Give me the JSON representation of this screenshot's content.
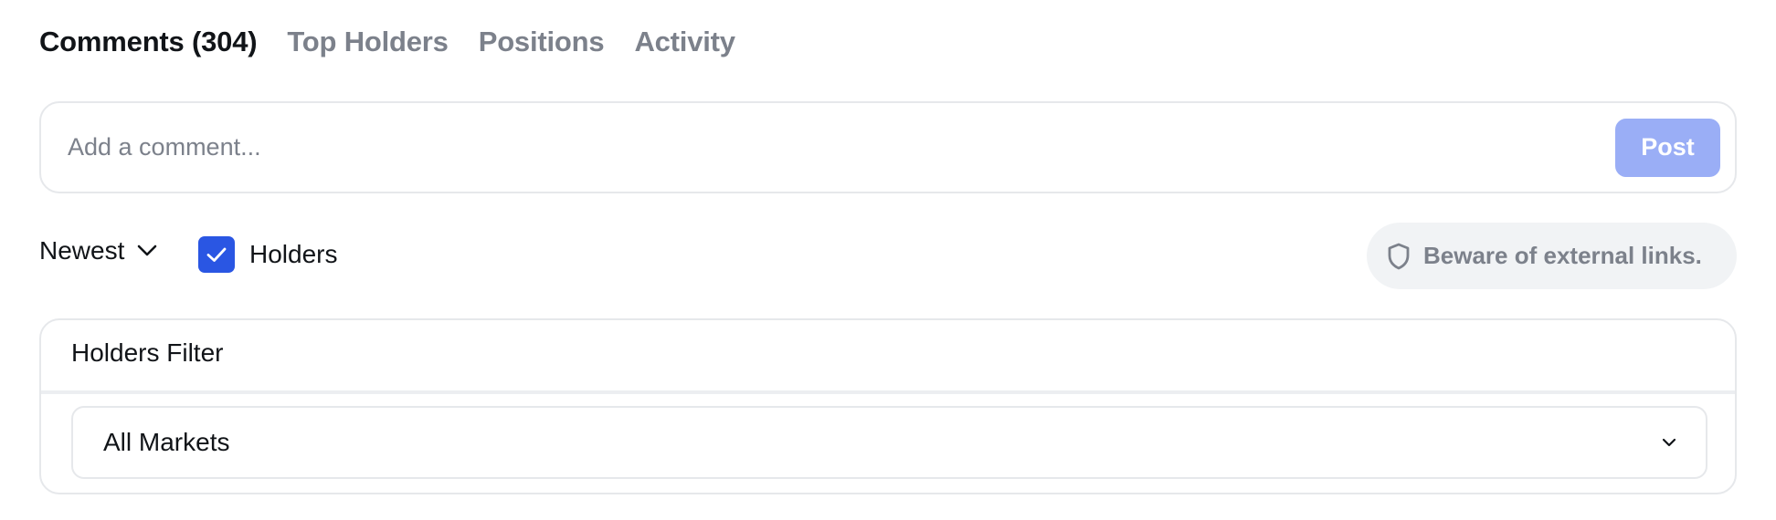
{
  "tabs": [
    {
      "label": "Comments (304)",
      "active": true
    },
    {
      "label": "Top Holders",
      "active": false
    },
    {
      "label": "Positions",
      "active": false
    },
    {
      "label": "Activity",
      "active": false
    }
  ],
  "comment": {
    "placeholder": "Add a comment...",
    "value": "",
    "post_label": "Post"
  },
  "sort": {
    "label": "Newest",
    "icon": "chevron-down-icon"
  },
  "holders_toggle": {
    "label": "Holders",
    "checked": true,
    "icon": "check-icon"
  },
  "warning": {
    "icon": "shield-icon",
    "text": "Beware of external links."
  },
  "holders_filter": {
    "title": "Holders Filter",
    "selected": "All Markets",
    "icon": "chevron-down-icon"
  },
  "colors": {
    "accent": "#2a56e3",
    "post_button": "#9aaef6",
    "muted_text": "#7c818b",
    "border": "#e6e8eb",
    "pill_bg": "#f1f3f5"
  }
}
